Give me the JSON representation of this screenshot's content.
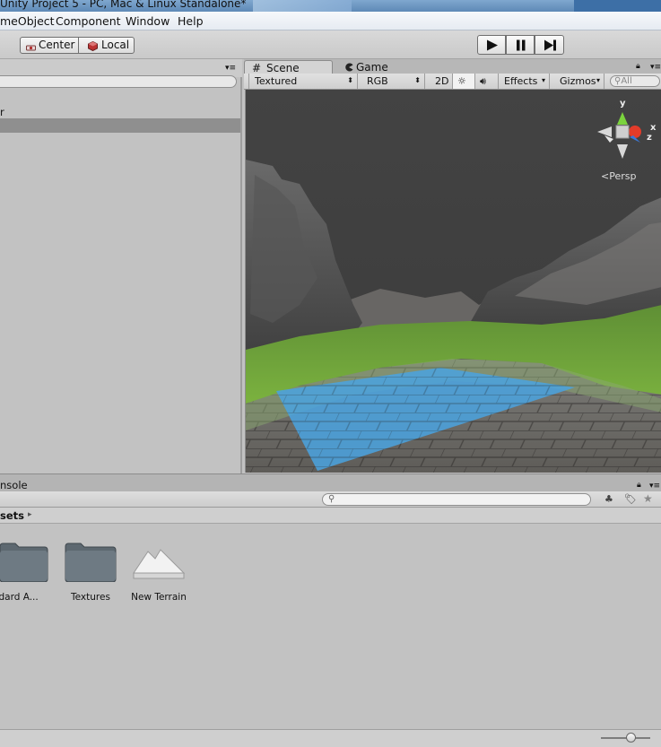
{
  "window": {
    "title": "Unity Project 5 - PC, Mac & Linux Standalone*"
  },
  "menu": {
    "items": [
      "meObject",
      "Component",
      "Window",
      "Help"
    ]
  },
  "toolbar": {
    "pivot_center": "Center",
    "pivot_local": "Local"
  },
  "hierarchy": {
    "rows": [
      "r",
      ""
    ]
  },
  "scene": {
    "tabs": {
      "scene": "Scene",
      "game": "Game"
    },
    "toolbar": {
      "render_mode": "Textured",
      "color_mode": "RGB",
      "mode_2d": "2D",
      "effects": "Effects",
      "gizmos": "Gizmos",
      "search_placeholder": "All"
    },
    "gizmo": {
      "y": "y",
      "x": "x",
      "z": "z",
      "projection": "Persp"
    }
  },
  "console": {
    "tab_label": "nsole"
  },
  "project": {
    "breadcrumb": "sets",
    "assets": [
      {
        "name": "tandard A...",
        "kind": "folder"
      },
      {
        "name": "Textures",
        "kind": "folder"
      },
      {
        "name": "New Terrain",
        "kind": "terrain"
      }
    ]
  },
  "colors": {
    "selection": "#8f8f8f",
    "water": "#4aa3e0",
    "grass": "#6fa83a"
  },
  "zoom_slider": {
    "value": 0.6
  }
}
